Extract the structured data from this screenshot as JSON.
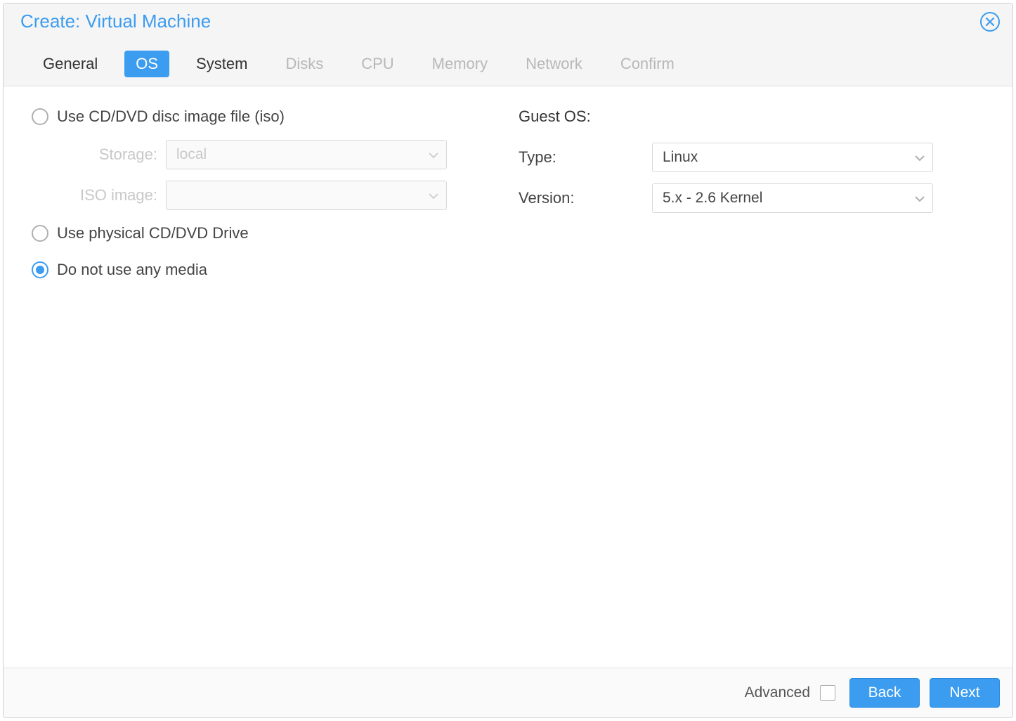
{
  "dialog": {
    "title": "Create: Virtual Machine"
  },
  "tabs": [
    {
      "label": "General",
      "state": "enabled"
    },
    {
      "label": "OS",
      "state": "active"
    },
    {
      "label": "System",
      "state": "enabled"
    },
    {
      "label": "Disks",
      "state": "disabled"
    },
    {
      "label": "CPU",
      "state": "disabled"
    },
    {
      "label": "Memory",
      "state": "disabled"
    },
    {
      "label": "Network",
      "state": "disabled"
    },
    {
      "label": "Confirm",
      "state": "disabled"
    }
  ],
  "media": {
    "option_iso": "Use CD/DVD disc image file (iso)",
    "option_physical": "Use physical CD/DVD Drive",
    "option_none": "Do not use any media",
    "selected": "none",
    "storage_label": "Storage:",
    "storage_value": "local",
    "iso_label": "ISO image:",
    "iso_value": ""
  },
  "guest_os": {
    "heading": "Guest OS:",
    "type_label": "Type:",
    "type_value": "Linux",
    "version_label": "Version:",
    "version_value": "5.x - 2.6 Kernel"
  },
  "footer": {
    "advanced_label": "Advanced",
    "advanced_checked": false,
    "back_label": "Back",
    "next_label": "Next"
  }
}
